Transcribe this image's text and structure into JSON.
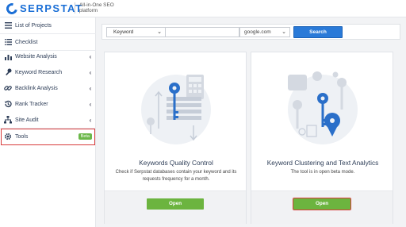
{
  "brand": {
    "name": "SERPSTAT",
    "tagline": "All-in-One SEO platform"
  },
  "sidebar": {
    "items": [
      {
        "label": "List of Projects",
        "icon": "menu-icon",
        "chevron": false
      },
      {
        "label": "Checklist",
        "icon": "checklist-icon",
        "chevron": false
      },
      {
        "label": "Website Analysis",
        "icon": "bar-chart-icon",
        "chevron": true
      },
      {
        "label": "Keyword Research",
        "icon": "key-icon",
        "chevron": true
      },
      {
        "label": "Backlink Analysis",
        "icon": "link-icon",
        "chevron": true
      },
      {
        "label": "Rank Tracker",
        "icon": "history-icon",
        "chevron": true
      },
      {
        "label": "Site Audit",
        "icon": "sitemap-icon",
        "chevron": true
      },
      {
        "label": "Tools",
        "icon": "gear-icon",
        "badge": "Beta",
        "highlighted": true
      }
    ],
    "chevron_glyph": "‹"
  },
  "search": {
    "type_selected": "Keyword",
    "query_value": "",
    "database_selected": "google.com",
    "button_label": "Search"
  },
  "cards": [
    {
      "title": "Keywords Quality Control",
      "description": "Check if Serpstat databases contain your keyword and its requests frequency for a month.",
      "button_label": "Open",
      "highlighted": false
    },
    {
      "title": "Keyword Clustering and Text Analytics",
      "description": "The tool is in open beta mode.",
      "button_label": "Open",
      "highlighted": true
    }
  ],
  "colors": {
    "brand_blue": "#1b6fd6",
    "search_button": "#2a7ad8",
    "open_button": "#6cb43f",
    "beta_badge": "#6bb84a",
    "highlight_red": "#d83b3b",
    "illustration_key": "#2a6fc9"
  }
}
